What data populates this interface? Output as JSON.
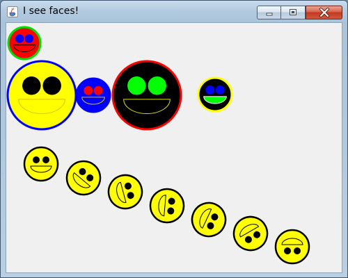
{
  "window": {
    "title": "I see faces!",
    "app_icon": "java-cup-icon",
    "controls": {
      "minimize_icon": "minimize-icon",
      "maximize_icon": "maximize-icon",
      "close_icon": "close-icon"
    }
  },
  "colors": {
    "client_bg": "#f0f0f0",
    "face_outline": "#000000",
    "smile_line": "#000000"
  },
  "faces": [
    {
      "name": "face-small-red",
      "fill": "#ff0000",
      "ring": "#00e000",
      "eyes": "#0000ff",
      "mouth": "#ff0000",
      "mouth_line": "#000000"
    },
    {
      "name": "face-large-yellow",
      "fill": "#ffff00",
      "ring": "#0000ff",
      "eyes": "#000000",
      "mouth": "#ffff00",
      "mouth_line": "#e0c000"
    },
    {
      "name": "face-small-blue",
      "fill": "#0000ff",
      "ring": "#0000ff",
      "eyes": "#ff0000",
      "mouth": "#0000ff",
      "mouth_line": "#e0c000"
    },
    {
      "name": "face-large-black",
      "fill": "#000000",
      "ring": "#ff0000",
      "eyes": "#00ff00",
      "mouth": "#000000",
      "mouth_line": "#e0e000"
    },
    {
      "name": "face-small-black",
      "fill": "#000000",
      "ring": "#ffff00",
      "eyes": "#0000ff",
      "mouth": "#00ff00",
      "mouth_line": "#ffffff"
    }
  ],
  "rotating_faces": {
    "fill": "#ffff00",
    "outline": "#000000",
    "eyes": "#000000",
    "count": 7
  }
}
